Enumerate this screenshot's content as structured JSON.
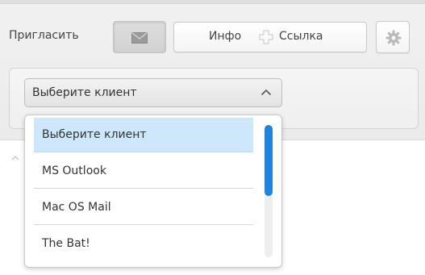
{
  "toolbar": {
    "invite_label": "Пригласить",
    "info_label": "Инфо",
    "link_label": "Ссылка"
  },
  "client_select": {
    "selected_value": "Выберите клиент",
    "options": [
      {
        "label": "Выберите клиент",
        "selected": true
      },
      {
        "label": "MS Outlook",
        "selected": false
      },
      {
        "label": "Mac OS Mail",
        "selected": false
      },
      {
        "label": "The Bat!",
        "selected": false
      }
    ]
  },
  "colors": {
    "accent": "#1f84dc",
    "selected_option_bg": "#cde8fb"
  },
  "icons": [
    "envelope-icon",
    "plus-icon",
    "gear-icon",
    "chevron-up-icon"
  ]
}
